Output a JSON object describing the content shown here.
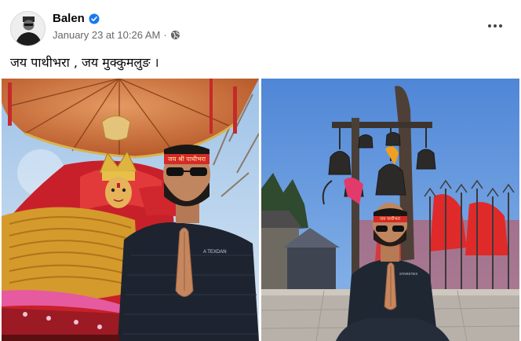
{
  "post": {
    "author": "Balen",
    "timestamp": "January 23 at 10:26 AM",
    "privacy_icon": "globe-icon",
    "verified_icon": "verified-badge-icon",
    "more_icon": "more-options-icon",
    "caption": "जय पाथीभरा , जय मुक्कुमलुङ ।"
  },
  "photos": [
    {
      "id": "photo-temple-goddess",
      "headband_text": "जय श्री पाथीभरा",
      "jacket_text": "A TEXDAN"
    },
    {
      "id": "photo-bells-shrine",
      "headband_text": "जय पाथीभरा",
      "jacket_text": "STARKTEX"
    }
  ],
  "colors": {
    "verified": "#1877f2",
    "meta": "#65676b",
    "text": "#050505"
  }
}
